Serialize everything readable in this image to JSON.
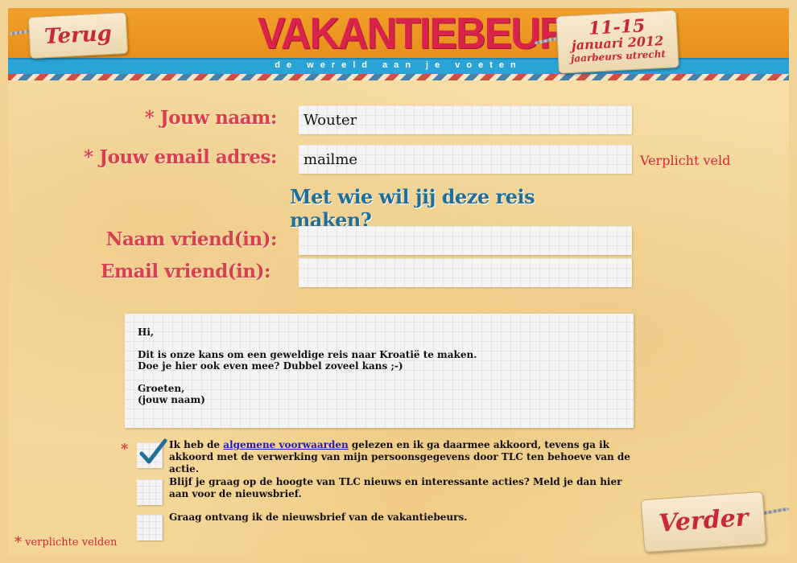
{
  "header": {
    "back_label": "Terug",
    "logo": "VAKANTIEBEURS",
    "tagline": "de wereld aan je voeten",
    "date_range": "11-15",
    "date_month": "januari 2012",
    "venue": "jaarbeurs utrecht"
  },
  "form": {
    "name_label": "Jouw naam:",
    "name_value": "Wouter",
    "email_label": "Jouw email adres:",
    "email_value": "mailme",
    "email_error": "Verplicht veld",
    "question": "Met wie wil jij deze reis maken?",
    "friend_name_label": "Naam vriend(in):",
    "friend_name_value": "",
    "friend_email_label": "Email vriend(in):",
    "friend_email_value": "",
    "required_marker": "*"
  },
  "message": {
    "line1": "Hi,",
    "line2": "Dit is onze kans om een geweldige reis naar Kroatië te maken.",
    "line3": "Doe je hier ook even mee? Dubbel zoveel kans ;-)",
    "line4": "Groeten,",
    "line5": "(jouw naam)"
  },
  "checkboxes": [
    {
      "checked": true,
      "required": true,
      "text_before": "Ik heb de ",
      "link_text": "algemene voorwaarden",
      "text_after": " gelezen en ik ga daarmee akkoord, tevens ga ik akkoord met de verwerking van mijn persoonsgegevens door TLC ten behoeve van de actie."
    },
    {
      "checked": false,
      "required": false,
      "text": "Blijf je graag op de hoogte van TLC nieuws en interessante acties? Meld je dan hier aan voor de nieuwsbrief."
    },
    {
      "checked": false,
      "required": false,
      "text": "Graag ontvang ik de nieuwsbrief van de vakantiebeurs."
    }
  ],
  "footer": {
    "required_note": "verplichte velden",
    "next_label": "Verder"
  },
  "colors": {
    "accent_red": "#d8404f",
    "header_orange": "#f0a02a",
    "header_blue": "#2aa3d6",
    "question_blue": "#1f6f99",
    "check_blue": "#1f6f99"
  }
}
